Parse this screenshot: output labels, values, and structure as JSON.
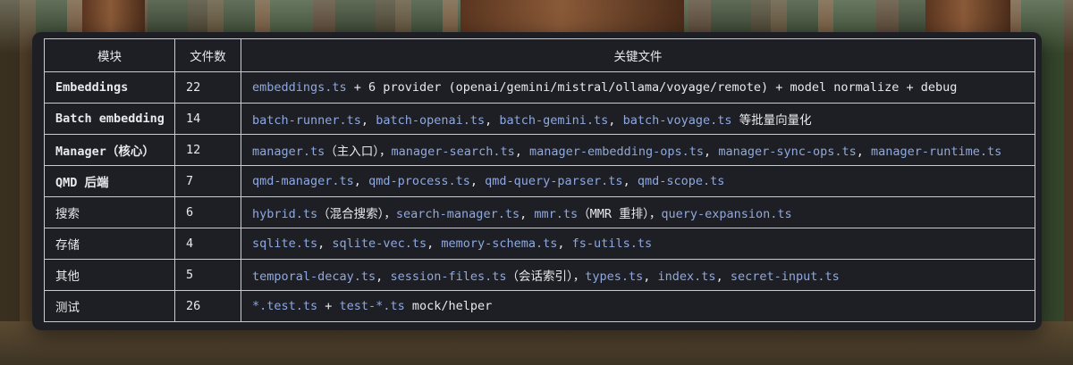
{
  "table": {
    "headers": [
      "模块",
      "文件数",
      "关键文件"
    ],
    "rows": [
      {
        "module": "Embeddings",
        "bold": true,
        "count": "22",
        "parts": [
          {
            "t": "embeddings.ts",
            "code": true
          },
          {
            "t": " + 6 provider (openai/gemini/mistral/ollama/voyage/remote) + model normalize + debug",
            "code": false
          }
        ]
      },
      {
        "module": "Batch embedding",
        "bold": true,
        "count": "14",
        "parts": [
          {
            "t": "batch-runner.ts",
            "code": true
          },
          {
            "t": ", ",
            "code": false
          },
          {
            "t": "batch-openai.ts",
            "code": true
          },
          {
            "t": ", ",
            "code": false
          },
          {
            "t": "batch-gemini.ts",
            "code": true
          },
          {
            "t": ", ",
            "code": false
          },
          {
            "t": "batch-voyage.ts",
            "code": true
          },
          {
            "t": " 等批量向量化",
            "code": false
          }
        ]
      },
      {
        "module": "Manager（核心）",
        "bold": true,
        "count": "12",
        "parts": [
          {
            "t": "manager.ts",
            "code": true
          },
          {
            "t": "（主入口），",
            "code": false
          },
          {
            "t": "manager-search.ts",
            "code": true
          },
          {
            "t": ", ",
            "code": false
          },
          {
            "t": "manager-embedding-ops.ts",
            "code": true
          },
          {
            "t": ", ",
            "code": false
          },
          {
            "t": "manager-sync-ops.ts",
            "code": true
          },
          {
            "t": ", ",
            "code": false
          },
          {
            "t": "manager-runtime.ts",
            "code": true
          }
        ]
      },
      {
        "module": "QMD 后端",
        "bold": true,
        "count": "7",
        "parts": [
          {
            "t": "qmd-manager.ts",
            "code": true
          },
          {
            "t": ", ",
            "code": false
          },
          {
            "t": "qmd-process.ts",
            "code": true
          },
          {
            "t": ", ",
            "code": false
          },
          {
            "t": "qmd-query-parser.ts",
            "code": true
          },
          {
            "t": ", ",
            "code": false
          },
          {
            "t": "qmd-scope.ts",
            "code": true
          }
        ]
      },
      {
        "module": "搜索",
        "bold": false,
        "count": "6",
        "parts": [
          {
            "t": "hybrid.ts",
            "code": true
          },
          {
            "t": "（混合搜索），",
            "code": false
          },
          {
            "t": "search-manager.ts",
            "code": true
          },
          {
            "t": ", ",
            "code": false
          },
          {
            "t": "mmr.ts",
            "code": true
          },
          {
            "t": "（MMR 重排），",
            "code": false
          },
          {
            "t": "query-expansion.ts",
            "code": true
          }
        ]
      },
      {
        "module": "存储",
        "bold": false,
        "count": "4",
        "parts": [
          {
            "t": "sqlite.ts",
            "code": true
          },
          {
            "t": ", ",
            "code": false
          },
          {
            "t": "sqlite-vec.ts",
            "code": true
          },
          {
            "t": ", ",
            "code": false
          },
          {
            "t": "memory-schema.ts",
            "code": true
          },
          {
            "t": ", ",
            "code": false
          },
          {
            "t": "fs-utils.ts",
            "code": true
          }
        ]
      },
      {
        "module": "其他",
        "bold": false,
        "count": "5",
        "parts": [
          {
            "t": "temporal-decay.ts",
            "code": true
          },
          {
            "t": ", ",
            "code": false
          },
          {
            "t": "session-files.ts",
            "code": true
          },
          {
            "t": "（会话索引），",
            "code": false
          },
          {
            "t": "types.ts",
            "code": true
          },
          {
            "t": ", ",
            "code": false
          },
          {
            "t": "index.ts",
            "code": true
          },
          {
            "t": ", ",
            "code": false
          },
          {
            "t": "secret-input.ts",
            "code": true
          }
        ]
      },
      {
        "module": "测试",
        "bold": false,
        "count": "26",
        "parts": [
          {
            "t": "*.test.ts",
            "code": true
          },
          {
            "t": " + ",
            "code": false
          },
          {
            "t": "test-*.ts",
            "code": true
          },
          {
            "t": " mock/helper",
            "code": false
          }
        ]
      }
    ]
  },
  "colors": {
    "panel": "#1d1f24",
    "code_text": "#8fa8e0",
    "plain_text": "#e8e9ec",
    "border": "#c9cbd0"
  }
}
